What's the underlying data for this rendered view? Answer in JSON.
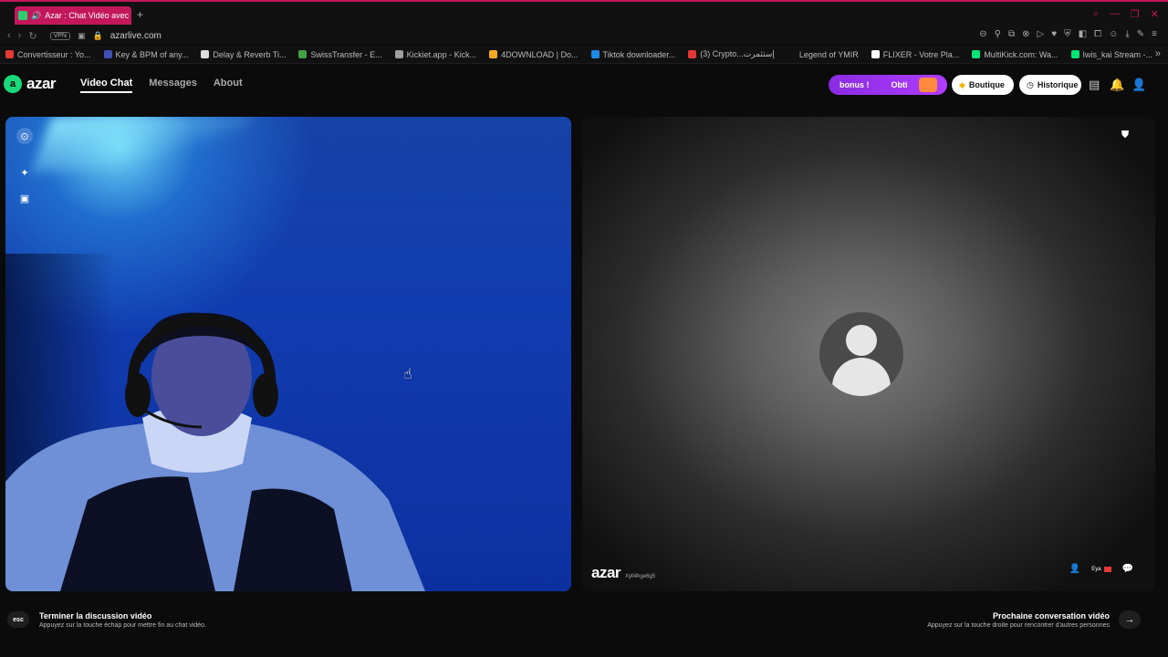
{
  "browser": {
    "tab_title": "Azar : Chat Vidéo avec",
    "url": "azarlive.com",
    "vpn_label": "VPN",
    "bookmarks": [
      {
        "label": "Convertisseur : Yo...",
        "color": "#e53935"
      },
      {
        "label": "Key & BPM of any...",
        "color": "#3f51b5"
      },
      {
        "label": "Delay & Reverb Ti...",
        "color": "#dddddd"
      },
      {
        "label": "SwissTransfer - E...",
        "color": "#43a047"
      },
      {
        "label": "Kickiet.app - Kick...",
        "color": "#9e9e9e"
      },
      {
        "label": "4DOWNLOAD | Do...",
        "color": "#f9a825"
      },
      {
        "label": "Tiktok downloader...",
        "color": "#1e88e5"
      },
      {
        "label": "(3) Crypto...إستثمرت",
        "color": "#e53935"
      },
      {
        "label": "Legend of YMIR",
        "color": "#111111"
      },
      {
        "label": "FLIXER - Votre Pla...",
        "color": "#ffffff"
      },
      {
        "label": "MultiKick.com: Wa...",
        "color": "#00e676"
      },
      {
        "label": "Iwis_kai Stream -...",
        "color": "#00e676"
      }
    ]
  },
  "app": {
    "logo": "azar",
    "nav": {
      "video_chat": "Video Chat",
      "messages": "Messages",
      "about": "About"
    },
    "bonus": {
      "part1": "bonus !",
      "part2": "Obti"
    },
    "boutique": "Boutique",
    "historique": "Historique",
    "colors": {
      "accent": "#19d97b",
      "bonus": "#9b30ff"
    }
  },
  "video_right": {
    "watermark": "azar",
    "watermark_id": "Xyll4hge6g5",
    "mini_user": "Eya"
  },
  "footer": {
    "esc_label": "esc",
    "end_title": "Terminer la discussion vidéo",
    "end_sub": "Appuyez sur la touche échap pour mettre fin au chat vidéo.",
    "next_title": "Prochaine conversation vidéo",
    "next_sub": "Appuyez sur la touche droite pour rencontrer d'autres personnes"
  }
}
